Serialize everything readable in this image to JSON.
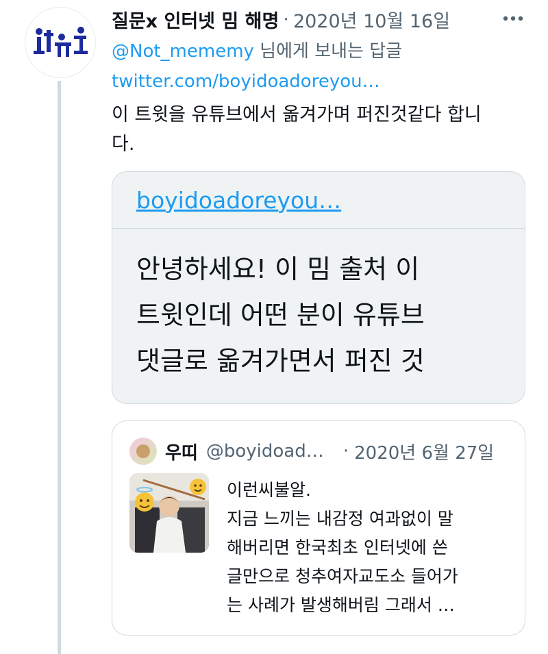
{
  "tweet": {
    "author_name": "질문x 인터넷 밈 해명",
    "separator": "·",
    "date": "2020년 10월 16일",
    "more_icon": "more-dots-icon",
    "reply_to_handle": "@Not_mememy",
    "reply_to_suffix": " 님에게 보내는 답글",
    "link": "twitter.com/boyidoadoreyou…",
    "text_lines": [
      "이 트윗을 유튜브에서 옮겨가며 퍼진것같다 합니",
      "다."
    ]
  },
  "card": {
    "link": "boyidoadoreyou…",
    "lines": [
      "안녕하세요! 이 밈 출처 이",
      "트윗인데 어떤 분이 유튜브",
      "댓글로 옮겨가면서 퍼진 것"
    ]
  },
  "quote": {
    "name": "우띠",
    "handle": "@boyidoad…",
    "separator": "·",
    "date": "2020년 6월 27일",
    "lines": [
      "이런씨불알.",
      "지금 느끼는 내감정 여과없이 말",
      "해버리면 한국최초 인터넷에 쓴",
      "글만으로 청추여자교도소 들어가",
      "는 사례가 발생해버림 그래서 …"
    ]
  }
}
